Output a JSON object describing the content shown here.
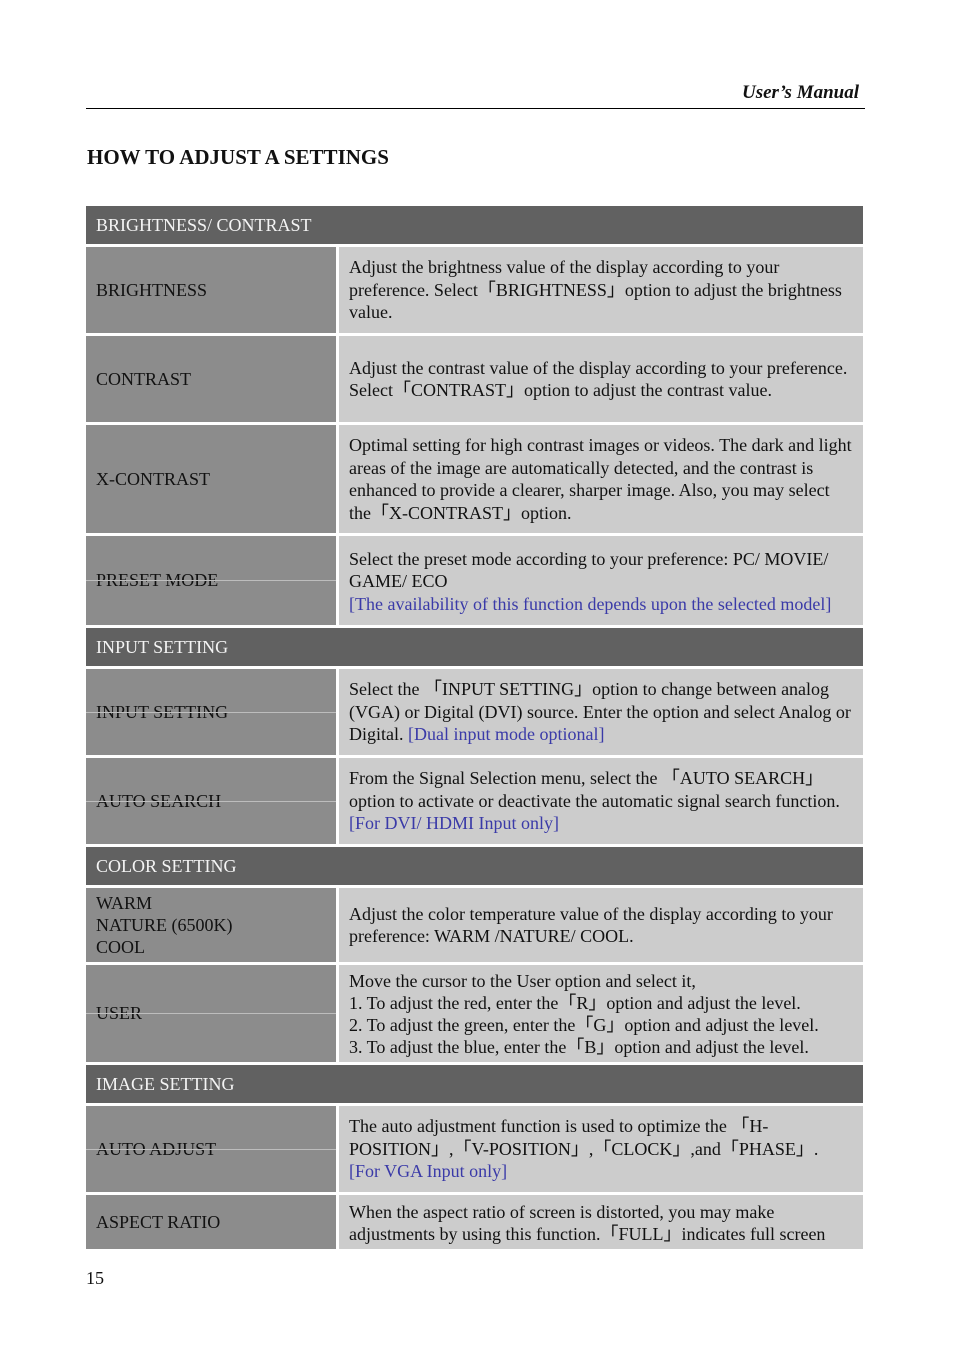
{
  "header": {
    "running_head": "User’s Manual"
  },
  "title": "HOW TO ADJUST A SETTINGS",
  "sections": [
    {
      "heading": "BRIGHTNESS/ CONTRAST",
      "rows": [
        {
          "label": "BRIGHTNESS",
          "desc": "Adjust the brightness value of the display according to your preference. Select「BRIGHTNESS」option to adjust the brightness value.",
          "note": ""
        },
        {
          "label": "CONTRAST",
          "desc": "Adjust the contrast value of the display according to your preference. Select「CONTRAST」option to adjust the contrast value.",
          "note": ""
        },
        {
          "label": "X-CONTRAST",
          "desc": "Optimal setting for high contrast images or videos. The dark and light areas of the image are automatically detected, and the contrast is enhanced to provide a clearer, sharper image. Also, you may select the「X-CONTRAST」option.",
          "note": ""
        },
        {
          "label": "PRESET MODE",
          "desc": "Select the preset mode according to your preference: PC/ MOVIE/ GAME/ ECO",
          "note": "[The availability of this function depends upon the selected model]"
        }
      ]
    },
    {
      "heading": "INPUT SETTING",
      "rows": [
        {
          "label": "INPUT SETTING",
          "desc": "Select the 「INPUT SETTING」option to change between analog (VGA) or Digital (DVI) source. Enter the option and select Analog or Digital.",
          "note": "[Dual input mode optional]"
        },
        {
          "label": "AUTO SEARCH",
          "desc": "From the Signal Selection menu, select the 「AUTO SEARCH」option to activate or deactivate the automatic signal search function.",
          "note": "[For DVI/ HDMI Input only]"
        }
      ]
    },
    {
      "heading": "COLOR SETTING",
      "rows": [
        {
          "label_lines": [
            "WARM",
            "NATURE (6500K)",
            "COOL"
          ],
          "desc": "Adjust the color temperature value of the display according to your preference: WARM /NATURE/ COOL.",
          "note": ""
        },
        {
          "label": "USER",
          "desc_lines": [
            "Move the cursor to the User option and select it,",
            "1. To adjust the red, enter the「R」option and adjust the level.",
            "2. To adjust the green, enter the「G」option and adjust the level.",
            "3. To adjust the blue, enter the「B」option and adjust the level."
          ]
        }
      ]
    },
    {
      "heading": "IMAGE SETTING",
      "rows": [
        {
          "label": "AUTO ADJUST",
          "desc": "The auto adjustment function is used to optimize the 「H-POSITION」,「V-POSITION」,「CLOCK」,and「PHASE」.",
          "note": "[For VGA Input only]"
        },
        {
          "label": "ASPECT RATIO",
          "desc": "When the aspect ratio of screen is distorted, you may make adjustments by using this function.「FULL」indicates full screen",
          "note": ""
        }
      ]
    }
  ],
  "footer": {
    "page_number": "15"
  }
}
